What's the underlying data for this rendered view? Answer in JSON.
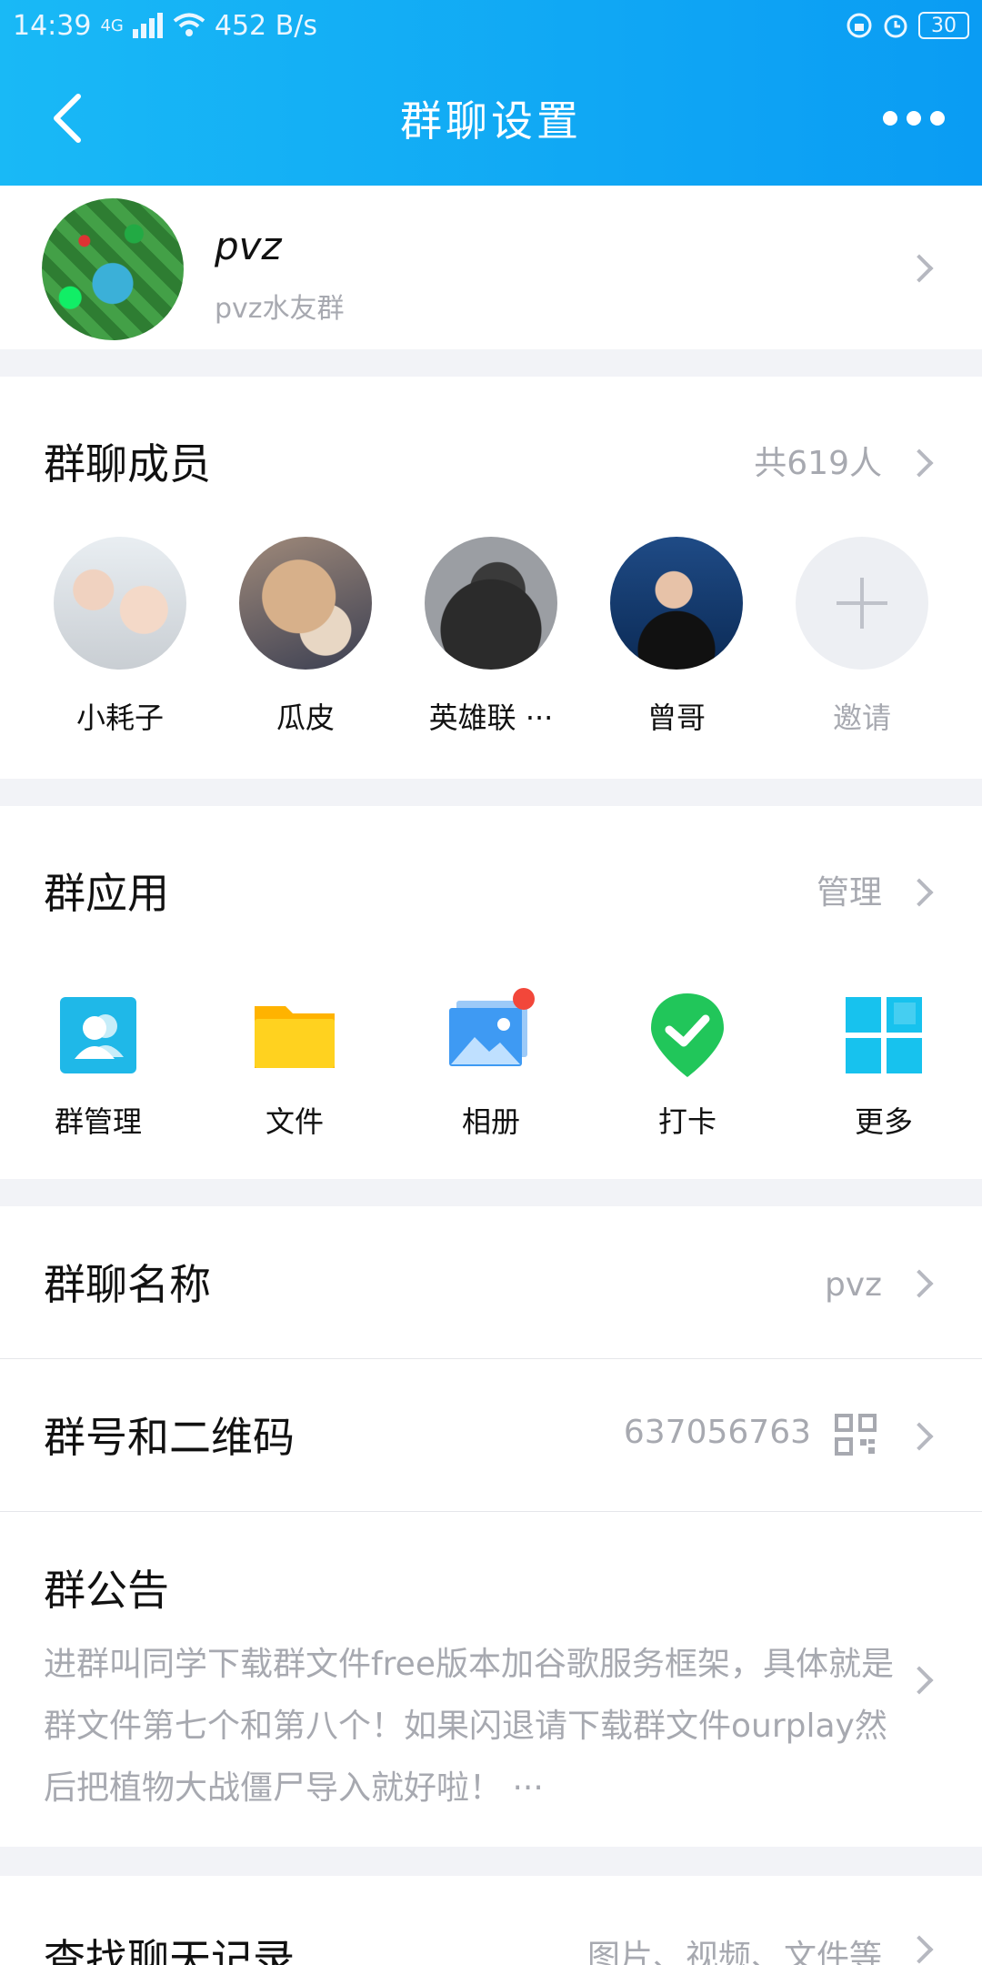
{
  "status_bar": {
    "time": "14:39",
    "network": "4G",
    "speed": "452 B/s",
    "battery": "30"
  },
  "nav": {
    "title": "群聊设置"
  },
  "group": {
    "name": "pvz",
    "description": "pvz水友群"
  },
  "members": {
    "title": "群聊成员",
    "count_label": "共619人",
    "list": [
      {
        "name": "小耗子"
      },
      {
        "name": "瓜皮"
      },
      {
        "name": "英雄联 ···"
      },
      {
        "name": "曾哥"
      }
    ],
    "invite_label": "邀请"
  },
  "apps": {
    "title": "群应用",
    "manage_label": "管理",
    "items": [
      {
        "label": "群管理",
        "icon": "group-manage-icon",
        "color": "#1fb8e8"
      },
      {
        "label": "文件",
        "icon": "folder-icon",
        "color": "#ffc400"
      },
      {
        "label": "相册",
        "icon": "album-icon",
        "color": "#3e9af3"
      },
      {
        "label": "打卡",
        "icon": "checkin-icon",
        "color": "#21c65a"
      },
      {
        "label": "更多",
        "icon": "grid-icon",
        "color": "#17c2ee"
      }
    ]
  },
  "settings": {
    "group_name_label": "群聊名称",
    "group_name_value": "pvz",
    "group_id_label": "群号和二维码",
    "group_id_value": "637056763",
    "notice_label": "群公告",
    "notice_text": "进群叫同学下载群文件free版本加谷歌服务框架，具体就是群文件第七个和第八个！如果闪退请下载群文件ourplay然后把植物大战僵尸导入就好啦！ ···",
    "search_label": "查找聊天记录",
    "search_value": "图片、视频、文件等"
  },
  "colors": {
    "header": "#0fa8f5",
    "badge": "#f2473a"
  }
}
